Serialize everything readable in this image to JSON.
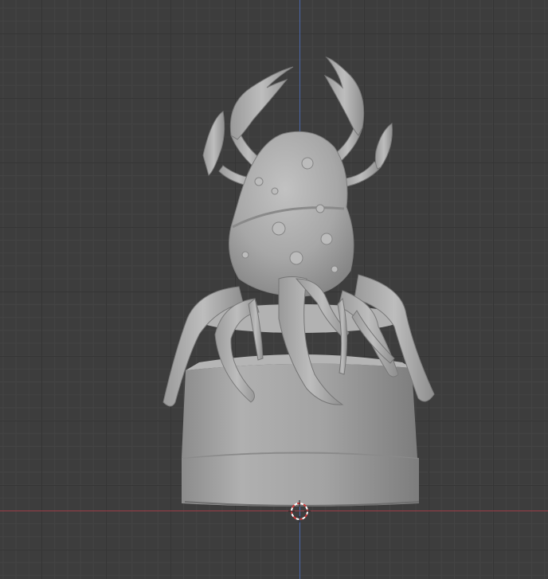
{
  "viewport": {
    "background": "#3d3d3d",
    "grid_minor_color": "#444444",
    "grid_major_color": "#353535",
    "axis_x_color": "#9a3c46",
    "axis_y_color": "#4a66a8"
  },
  "model": {
    "name": "crab-creature-on-pedestal",
    "material_color": "#a8a8a8"
  },
  "cursor": {
    "icon": "3d-cursor-icon",
    "ring_colors": [
      "#ffffff",
      "#d23c3c"
    ]
  }
}
